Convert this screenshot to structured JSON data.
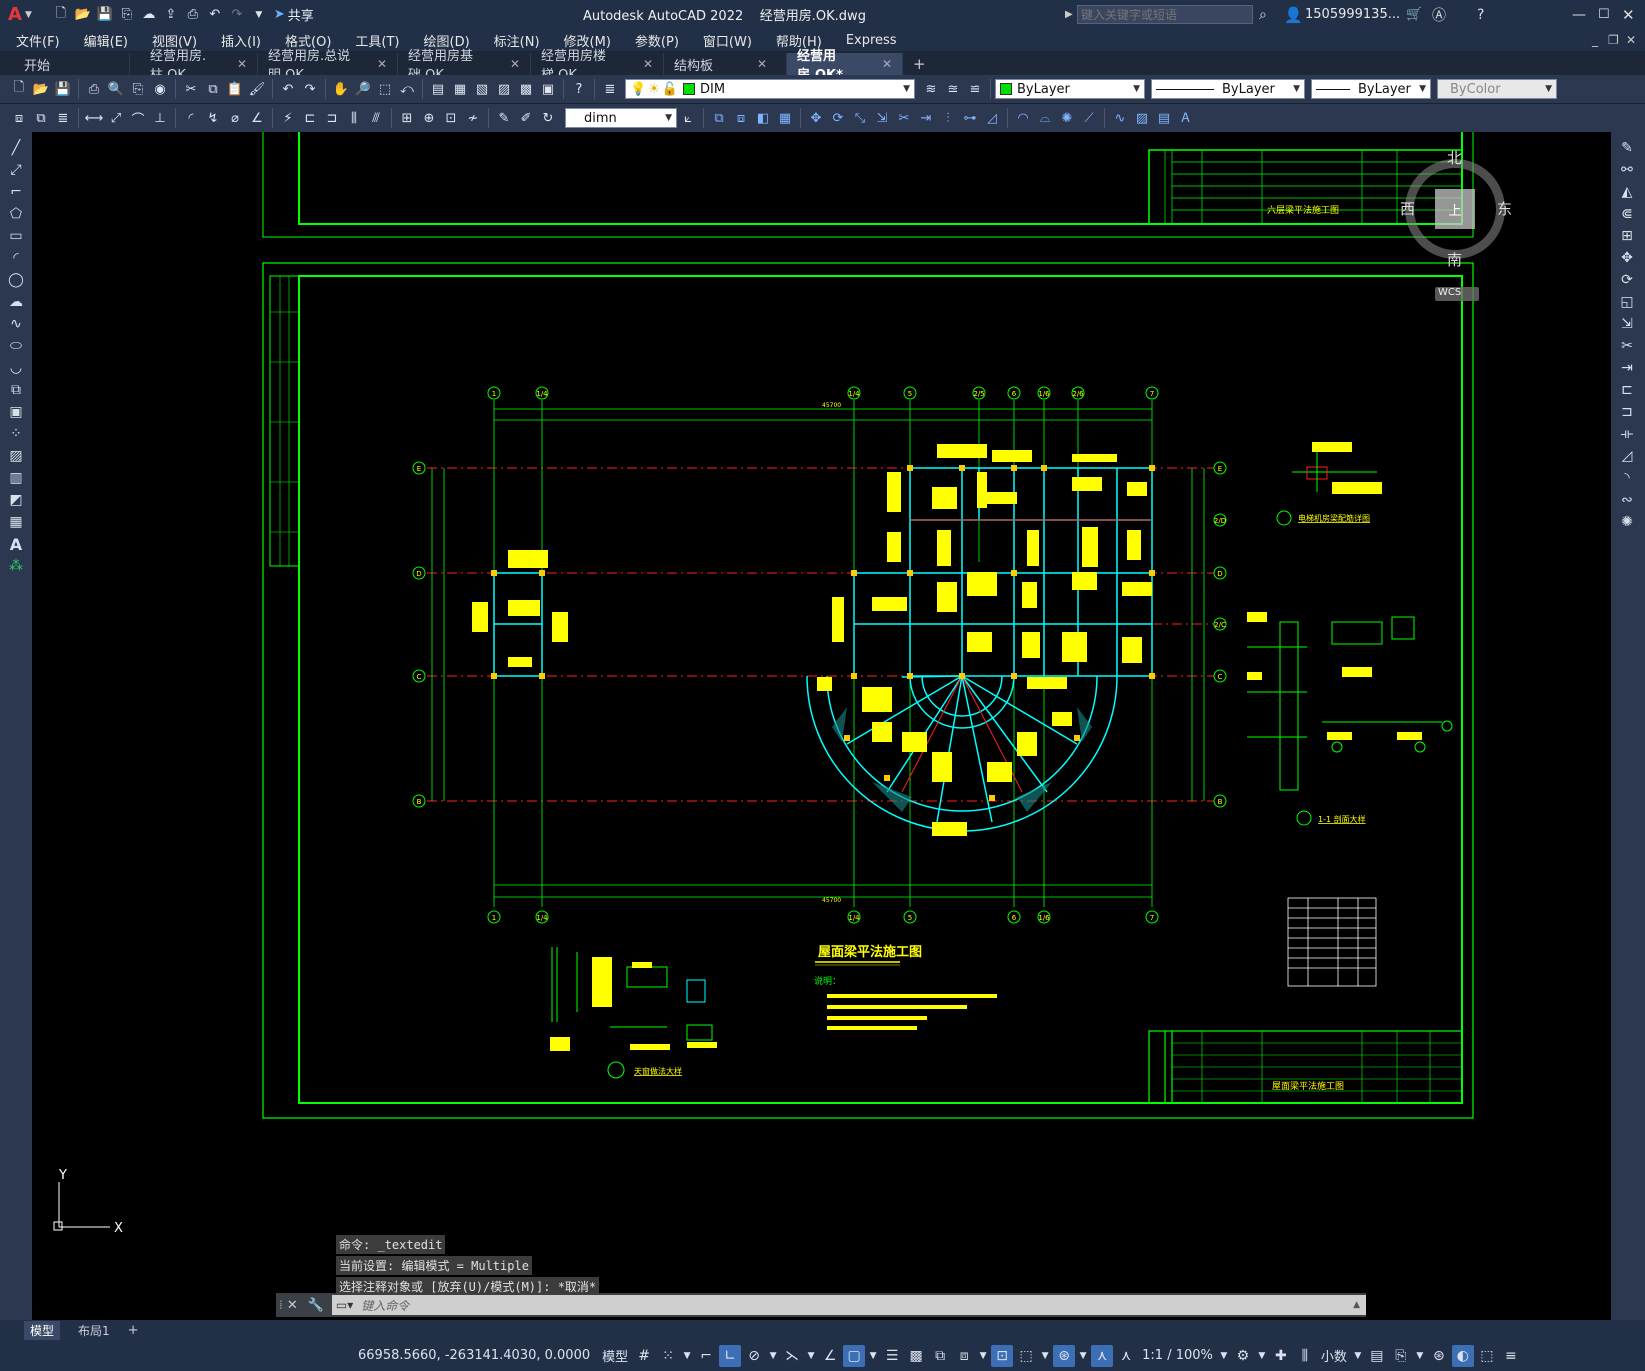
{
  "app": {
    "title": "Autodesk AutoCAD 2022",
    "filename": "经营用房.OK.dwg",
    "share": "共享",
    "search_placeholder": "键入关键字或短语",
    "user": "1505999135..."
  },
  "menu": [
    "文件(F)",
    "编辑(E)",
    "视图(V)",
    "插入(I)",
    "格式(O)",
    "工具(T)",
    "绘图(D)",
    "标注(N)",
    "修改(M)",
    "参数(P)",
    "窗口(W)",
    "帮助(H)",
    "Express"
  ],
  "tabs": [
    {
      "label": "开始",
      "closable": false
    },
    {
      "label": "经营用房.柱.OK",
      "closable": true
    },
    {
      "label": "经营用房.总说明.OK",
      "closable": true
    },
    {
      "label": "经营用房基础.OK",
      "closable": true
    },
    {
      "label": "经营用房楼梯.OK",
      "closable": true
    },
    {
      "label": "结构板",
      "closable": true
    },
    {
      "label": "经营用房.OK*",
      "closable": true,
      "active": true
    }
  ],
  "toolbar": {
    "layer": "DIM",
    "color": "ByLayer",
    "linetype": "ByLayer",
    "lineweight": "ByLayer",
    "plotstyle": "ByColor",
    "dimstyle": "dimn"
  },
  "viewcube": {
    "north": "北",
    "south": "南",
    "east": "东",
    "west": "西",
    "top": "上",
    "wcs": "WCS"
  },
  "ucs": {
    "x": "X",
    "y": "Y"
  },
  "drawing": {
    "title": "屋面梁平法施工图",
    "notes_title": "说明：",
    "detail1": "电梯机房梁配筋详图",
    "detail2": "1-1 剖面大样",
    "detail3": "天窗做法大样",
    "titleblock_top": "六层梁平法施工图",
    "titleblock_bottom": "屋面梁平法施工图",
    "grid_top": [
      "1",
      "1/4",
      "1/4",
      "5",
      "2/5",
      "6",
      "1/6",
      "2/6",
      "7"
    ],
    "grid_bottom": [
      "1",
      "1/4",
      "1/4",
      "5",
      "6",
      "1/6",
      "7"
    ],
    "grid_left": [
      "E",
      "D",
      "C",
      "B"
    ],
    "grid_right": [
      "E",
      "2/D",
      "D",
      "2/C",
      "C",
      "B"
    ],
    "dim_total": "45700"
  },
  "command": {
    "history": [
      "命令: _textedit",
      "当前设置: 编辑模式 = Multiple",
      "选择注释对象或 [放弃(U)/模式(M)]: *取消*"
    ],
    "placeholder": "键入命令"
  },
  "layout_tabs": [
    "模型",
    "布局1"
  ],
  "status": {
    "coords": "66958.5660, -263141.4030, 0.0000",
    "space": "模型",
    "scale": "1:1 / 100%",
    "units": "小数"
  },
  "colors": {
    "accent": "#3c6fb5",
    "frame": "#00ff00",
    "grid_line": "#00ff00",
    "axis_dash": "#ff0000",
    "text_yellow": "#ffff00"
  }
}
